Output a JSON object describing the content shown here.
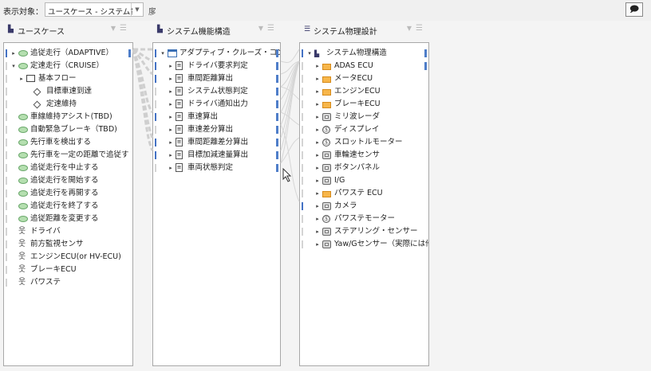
{
  "toolbar": {
    "label": "表示対象：",
    "combo_value": "ユースケース - システム論理構",
    "extra_icon": "layout-icon",
    "right_button_icon": "comment-icon"
  },
  "panels": [
    {
      "title": "ユースケース",
      "icon": "hierarchy-icon",
      "rows": [
        {
          "text": "追従走行（ADAPTIVE）",
          "icon": "usecase",
          "tw": "▸",
          "indent": 0,
          "link": true,
          "right": true
        },
        {
          "text": "定速走行（CRUISE）",
          "icon": "usecase",
          "tw": "▾",
          "indent": 0,
          "link": false,
          "right": false
        },
        {
          "text": "基本フロー",
          "icon": "flow",
          "tw": "▸",
          "indent": 1,
          "link": false,
          "right": false
        },
        {
          "text": "目標車速到達",
          "icon": "step",
          "tw": "",
          "indent": 2,
          "link": false,
          "right": false
        },
        {
          "text": "定速維持",
          "icon": "step",
          "tw": "",
          "indent": 2,
          "link": false,
          "right": false
        },
        {
          "text": "車線維持アシスト(TBD)",
          "icon": "usecase",
          "tw": "",
          "indent": 0,
          "link": false,
          "right": false
        },
        {
          "text": "自動緊急ブレーキ（TBD)",
          "icon": "usecase",
          "tw": "",
          "indent": 0,
          "link": false,
          "right": false
        },
        {
          "text": "先行車を検出する",
          "icon": "usecase",
          "tw": "",
          "indent": 0,
          "link": false,
          "right": false
        },
        {
          "text": "先行車を一定の距離で追従す",
          "icon": "usecase",
          "tw": "",
          "indent": 0,
          "link": false,
          "right": false
        },
        {
          "text": "追従走行を中止する",
          "icon": "usecase",
          "tw": "",
          "indent": 0,
          "link": false,
          "right": false
        },
        {
          "text": "追従走行を開始する",
          "icon": "usecase",
          "tw": "",
          "indent": 0,
          "link": false,
          "right": false
        },
        {
          "text": "追従走行を再開する",
          "icon": "usecase",
          "tw": "",
          "indent": 0,
          "link": false,
          "right": false
        },
        {
          "text": "追従走行を終了する",
          "icon": "usecase",
          "tw": "",
          "indent": 0,
          "link": false,
          "right": false
        },
        {
          "text": "追従距離を変更する",
          "icon": "usecase",
          "tw": "",
          "indent": 0,
          "link": false,
          "right": false
        },
        {
          "text": "ドライバ",
          "icon": "actor",
          "tw": "",
          "indent": 0,
          "link": false,
          "right": false
        },
        {
          "text": "前方監視センサ",
          "icon": "actor",
          "tw": "",
          "indent": 0,
          "link": false,
          "right": false
        },
        {
          "text": "エンジンECU(or HV-ECU)",
          "icon": "actor",
          "tw": "",
          "indent": 0,
          "link": false,
          "right": false
        },
        {
          "text": "ブレーキECU",
          "icon": "actor",
          "tw": "",
          "indent": 0,
          "link": false,
          "right": false
        },
        {
          "text": "パワステ",
          "icon": "actor",
          "tw": "",
          "indent": 0,
          "link": false,
          "right": false
        }
      ]
    },
    {
      "title": "システム機能構造",
      "icon": "hierarchy-icon",
      "rows": [
        {
          "text": "アダプティブ・クルーズ・コントロール",
          "icon": "window",
          "tw": "▾",
          "indent": 0,
          "link": true,
          "right": true
        },
        {
          "text": "ドライバ要求判定",
          "icon": "function",
          "tw": "▸",
          "indent": 1,
          "link": true,
          "right": true
        },
        {
          "text": "車間距離算出",
          "icon": "function",
          "tw": "▸",
          "indent": 1,
          "link": true,
          "right": true
        },
        {
          "text": "システム状態判定",
          "icon": "function",
          "tw": "▸",
          "indent": 1,
          "link": false,
          "right": true
        },
        {
          "text": "ドライバ通知出力",
          "icon": "function",
          "tw": "▸",
          "indent": 1,
          "link": false,
          "right": true
        },
        {
          "text": "車速算出",
          "icon": "function",
          "tw": "▸",
          "indent": 1,
          "link": true,
          "right": true
        },
        {
          "text": "車速差分算出",
          "icon": "function",
          "tw": "▸",
          "indent": 1,
          "link": false,
          "right": true
        },
        {
          "text": "車間距離差分算出",
          "icon": "function",
          "tw": "▸",
          "indent": 1,
          "link": true,
          "right": true
        },
        {
          "text": "目標加減速量算出",
          "icon": "function",
          "tw": "▸",
          "indent": 1,
          "link": true,
          "right": true
        },
        {
          "text": "車両状態判定",
          "icon": "function",
          "tw": "▸",
          "indent": 1,
          "link": false,
          "right": true
        }
      ]
    },
    {
      "title": "システム物理設計",
      "icon": "list-icon",
      "rows": [
        {
          "text": "システム物理構造",
          "icon": "stack",
          "tw": "▾",
          "indent": 0,
          "link": true,
          "right": true
        },
        {
          "text": "ADAS ECU",
          "icon": "folder",
          "tw": "▸",
          "indent": 1,
          "link": false,
          "right": true
        },
        {
          "text": "メータECU",
          "icon": "folder",
          "tw": "▸",
          "indent": 1,
          "link": false,
          "right": false
        },
        {
          "text": "エンジンECU",
          "icon": "folder",
          "tw": "▸",
          "indent": 1,
          "link": false,
          "right": false
        },
        {
          "text": "ブレーキECU",
          "icon": "folder",
          "tw": "▸",
          "indent": 1,
          "link": false,
          "right": false
        },
        {
          "text": "ミリ波レーダ",
          "icon": "device",
          "tw": "▸",
          "indent": 1,
          "link": false,
          "right": false
        },
        {
          "text": "ディスプレイ",
          "icon": "motor",
          "tw": "▸",
          "indent": 1,
          "link": false,
          "right": false
        },
        {
          "text": "スロットルモーター",
          "icon": "motor",
          "tw": "▸",
          "indent": 1,
          "link": false,
          "right": false
        },
        {
          "text": "車輪速センサ",
          "icon": "device",
          "tw": "▸",
          "indent": 1,
          "link": false,
          "right": false
        },
        {
          "text": "ボタンパネル",
          "icon": "device",
          "tw": "▸",
          "indent": 1,
          "link": false,
          "right": false
        },
        {
          "text": "I/G",
          "icon": "device",
          "tw": "▸",
          "indent": 1,
          "link": false,
          "right": false
        },
        {
          "text": "パワステ ECU",
          "icon": "folder",
          "tw": "▸",
          "indent": 1,
          "link": false,
          "right": false
        },
        {
          "text": "カメラ",
          "icon": "device",
          "tw": "▸",
          "indent": 1,
          "link": true,
          "right": false
        },
        {
          "text": "パワステモーター",
          "icon": "motor",
          "tw": "▸",
          "indent": 1,
          "link": false,
          "right": false
        },
        {
          "text": "ステアリング・センサー",
          "icon": "device",
          "tw": "▸",
          "indent": 1,
          "link": false,
          "right": false
        },
        {
          "text": "Yaw/Gセンサー（実際には他",
          "icon": "device",
          "tw": "▸",
          "indent": 1,
          "link": false,
          "right": false
        }
      ]
    }
  ]
}
